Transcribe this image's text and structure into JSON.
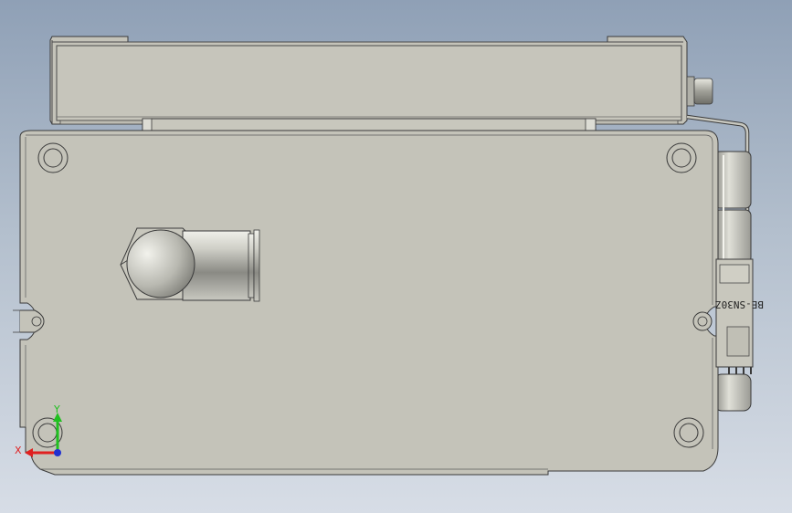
{
  "viewport": {
    "part_label": "BE-SN30Z",
    "triad": {
      "x_label": "X",
      "y_label": "Y",
      "x_color": "#e02020",
      "y_color": "#20c020",
      "z_color": "#2030d0"
    }
  },
  "colors": {
    "body": "#c4c3b9",
    "edge": "#3a3a3a",
    "background_top": "#8fa0b6",
    "background_bottom": "#d7dde6"
  }
}
